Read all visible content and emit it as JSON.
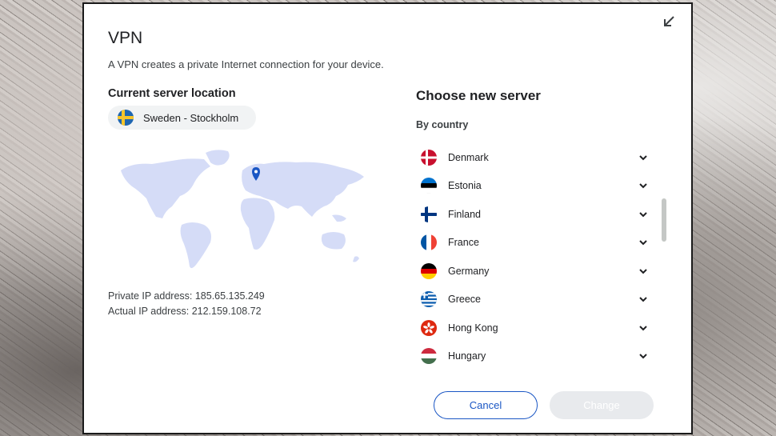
{
  "dialog": {
    "title": "VPN",
    "subtitle": "A VPN creates a private Internet connection for your device.",
    "collapse_icon": "collapse-arrow-icon"
  },
  "current": {
    "label": "Current server location",
    "location": "Sweden - Stockholm",
    "flag": "sweden-flag-icon",
    "private_ip": "Private IP address: 185.65.135.249",
    "actual_ip": "Actual IP address: 212.159.108.72"
  },
  "chooser": {
    "title": "Choose new server",
    "group_label": "By country",
    "countries": [
      {
        "name": "Denmark",
        "flag": "denmark-flag-icon"
      },
      {
        "name": "Estonia",
        "flag": "estonia-flag-icon"
      },
      {
        "name": "Finland",
        "flag": "finland-flag-icon"
      },
      {
        "name": "France",
        "flag": "france-flag-icon"
      },
      {
        "name": "Germany",
        "flag": "germany-flag-icon"
      },
      {
        "name": "Greece",
        "flag": "greece-flag-icon"
      },
      {
        "name": "Hong Kong",
        "flag": "hong-kong-flag-icon"
      },
      {
        "name": "Hungary",
        "flag": "hungary-flag-icon"
      }
    ]
  },
  "buttons": {
    "cancel": "Cancel",
    "change": "Change"
  },
  "colors": {
    "accent": "#1a56c4",
    "map_land": "#d5dcf7",
    "pin": "#1a56c4",
    "disabled_button": "#e8eaed"
  }
}
